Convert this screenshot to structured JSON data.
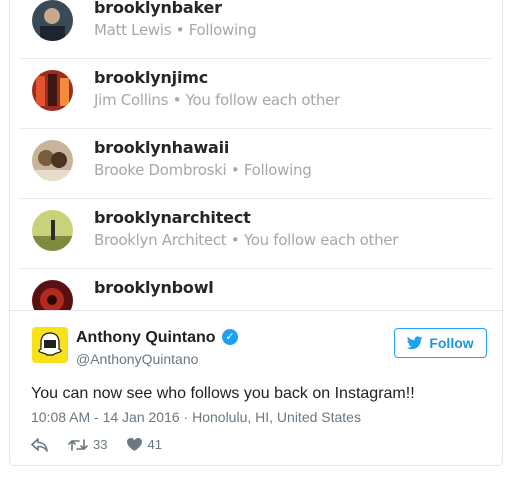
{
  "list": {
    "items": [
      {
        "username": "brooklynbaker",
        "full_name": "Matt Lewis",
        "separator": "•",
        "relation": "Following"
      },
      {
        "username": "brooklynjimc",
        "full_name": "Jim Collins",
        "separator": "•",
        "relation": "You follow each other"
      },
      {
        "username": "brooklynhawaii",
        "full_name": "Brooke Dombroski",
        "separator": "•",
        "relation": "Following"
      },
      {
        "username": "brooklynarchitect",
        "full_name": "Brooklyn Architect",
        "separator": "•",
        "relation": "You follow each other"
      },
      {
        "username": "brooklynbowl"
      }
    ]
  },
  "tweet": {
    "author_name": "Anthony Quintano",
    "author_handle": "@AnthonyQuintano",
    "follow_label": "Follow",
    "text": "You can now see who follows you back on Instagram!!",
    "timestamp": "10:08 AM - 14 Jan 2016 · Honolulu, HI, United States",
    "retweets": "33",
    "likes": "41",
    "accent_color": "#1da1f2"
  }
}
